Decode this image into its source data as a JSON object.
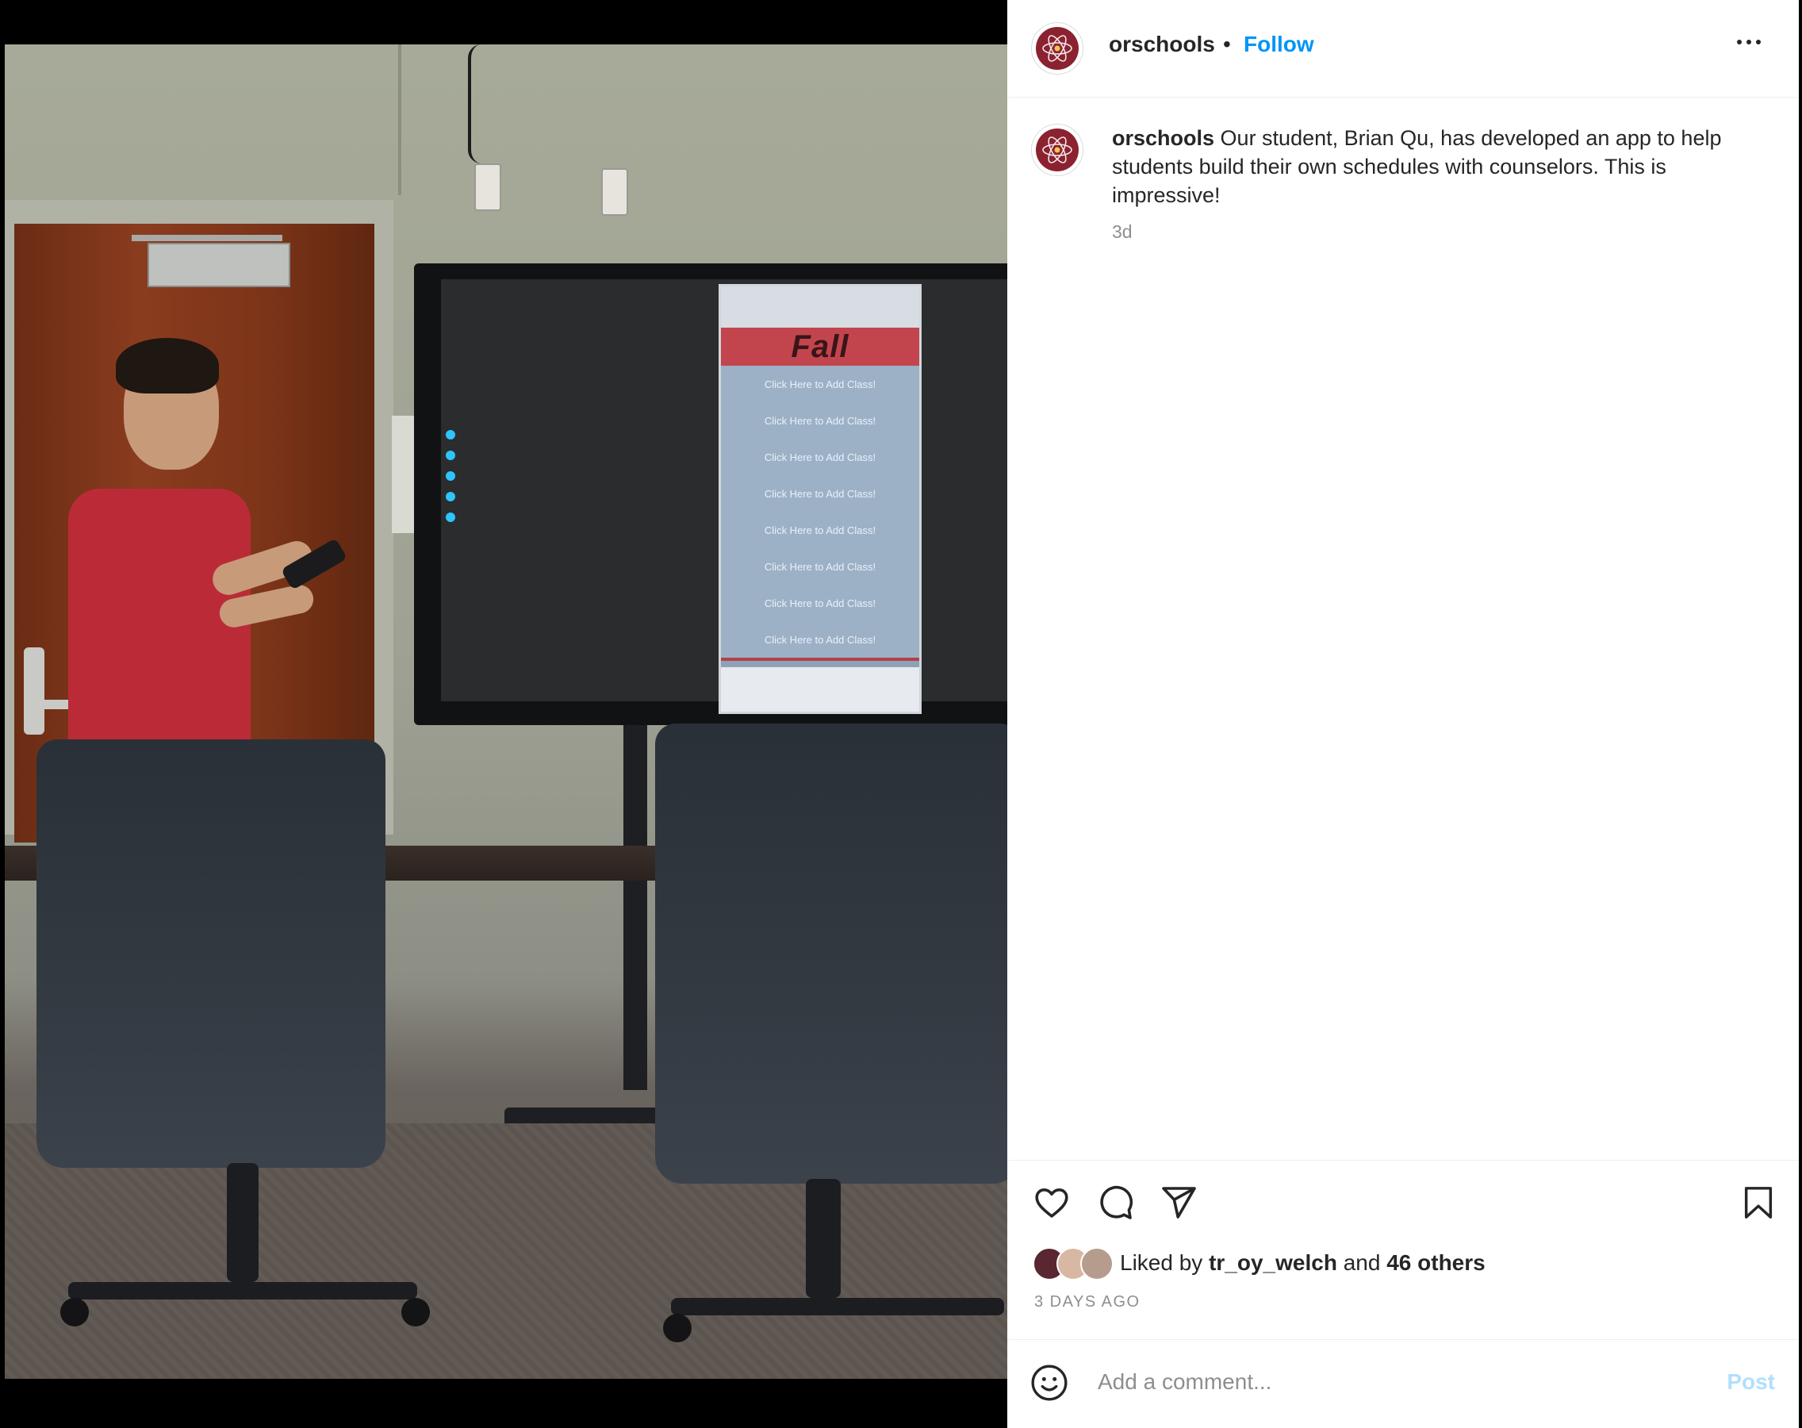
{
  "post": {
    "username": "orschools",
    "dot": "•",
    "follow_label": "Follow",
    "more_icon": "more-horizontal-icon"
  },
  "caption": {
    "username": "orschools",
    "text": "Our student, Brian Qu, has developed an app to help students build their own schedules with counselors. This is impressive!",
    "age": "3d"
  },
  "photo": {
    "screen_title": "Fall",
    "screen_rows": [
      "Click Here to Add Class!",
      "Click Here to Add Class!",
      "Click Here to Add Class!",
      "Click Here to Add Class!",
      "Click Here to Add Class!",
      "Click Here to Add Class!",
      "Click Here to Add Class!",
      "Click Here to Add Class!"
    ]
  },
  "actions": {
    "like_icon": "heart-icon",
    "comment_icon": "comment-bubble-icon",
    "share_icon": "paper-plane-icon",
    "save_icon": "bookmark-icon"
  },
  "likes": {
    "prefix": "Liked by",
    "user": "tr_oy_welch",
    "and": "and",
    "others": "46 others",
    "date": "3 DAYS AGO"
  },
  "comment": {
    "placeholder": "Add a comment...",
    "post_label": "Post",
    "emoji_icon": "smiley-icon"
  },
  "colors": {
    "brand_blue": "#0095f6",
    "post_disabled": "#b2dffc",
    "avatar_maroon": "#8b2230"
  }
}
